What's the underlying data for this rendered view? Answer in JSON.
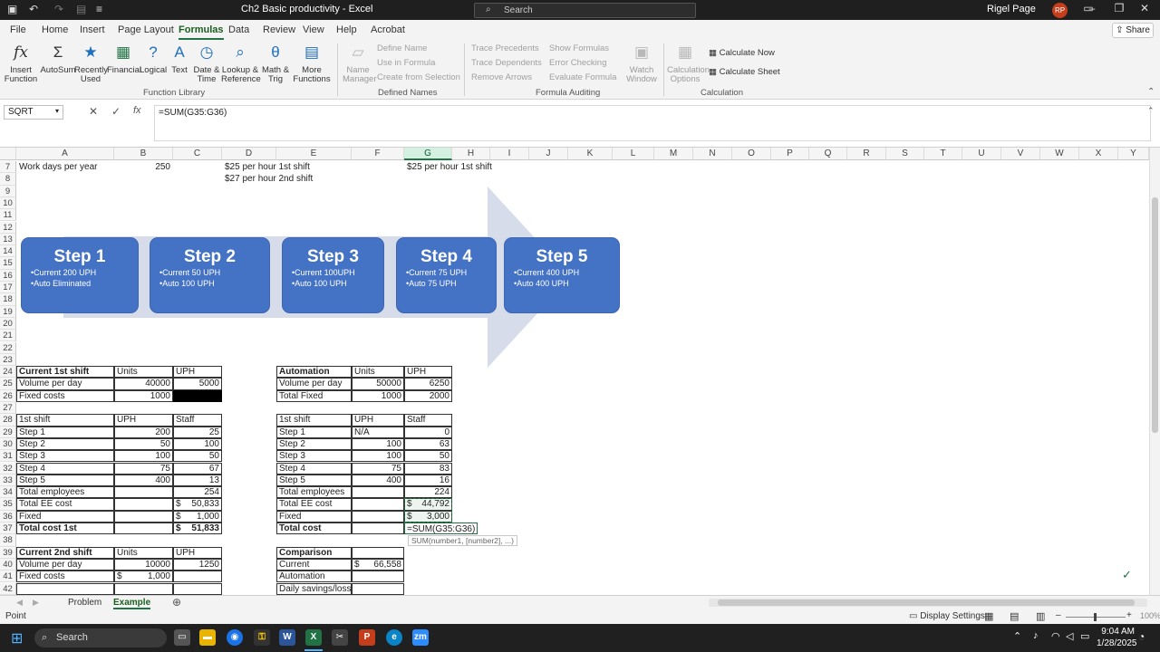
{
  "window": {
    "title": "Ch2 Basic productivity - Excel",
    "search_label": "Search",
    "user_name": "Rigel Page",
    "user_initials": "RP"
  },
  "tabs": [
    "File",
    "Home",
    "Insert",
    "Page Layout",
    "Formulas",
    "Data",
    "Review",
    "View",
    "Help",
    "Acrobat"
  ],
  "active_tab": "Formulas",
  "share_label": "Share",
  "ribbon": {
    "function_library": {
      "group_label": "Function Library",
      "insert_function": "Insert Function",
      "autosum": "AutoSum",
      "recently_used": "Recently Used",
      "financial": "Financial",
      "logical": "Logical",
      "text": "Text",
      "date_time": "Date & Time",
      "lookup_reference": "Lookup & Reference",
      "math_trig": "Math & Trig",
      "more_functions": "More Functions"
    },
    "defined_names": {
      "group_label": "Defined Names",
      "name_manager": "Name Manager",
      "define_name": "Define Name",
      "use_in_formula": "Use in Formula",
      "create_from_selection": "Create from Selection"
    },
    "formula_auditing": {
      "group_label": "Formula Auditing",
      "trace_precedents": "Trace Precedents",
      "trace_dependents": "Trace Dependents",
      "remove_arrows": "Remove Arrows",
      "show_formulas": "Show Formulas",
      "error_checking": "Error Checking",
      "evaluate_formula": "Evaluate Formula",
      "watch_window": "Watch Window"
    },
    "calculation": {
      "group_label": "Calculation",
      "calculation_options": "Calculation Options",
      "calculate_now": "Calculate Now",
      "calculate_sheet": "Calculate Sheet"
    }
  },
  "formula_bar": {
    "name_box": "SQRT",
    "formula": "=SUM(G35:G36)"
  },
  "columns": [
    "A",
    "B",
    "C",
    "D",
    "E",
    "F",
    "G",
    "H",
    "I",
    "J",
    "K",
    "L",
    "M",
    "N",
    "O",
    "P",
    "Q",
    "R",
    "S",
    "T",
    "U",
    "V",
    "W",
    "X",
    "Y"
  ],
  "rows": [
    "7",
    "8",
    "9",
    "10",
    "11",
    "12",
    "13",
    "14",
    "15",
    "16",
    "17",
    "18",
    "19",
    "20",
    "21",
    "22",
    "23",
    "24",
    "25",
    "26",
    "27",
    "28",
    "29",
    "30",
    "31",
    "32",
    "33",
    "34",
    "35",
    "36",
    "37",
    "38",
    "39",
    "40",
    "41",
    "42"
  ],
  "cells": {
    "A7": "Work days per year",
    "B7": "250",
    "D7": "$25 per hour 1st shift",
    "G7": "$25 per hour 1st shift",
    "D8": "$27 per hour 2nd shift",
    "A24": "Current 1st shift",
    "B24": "Units",
    "C24": "UPH",
    "A25": "Volume per day",
    "B25": "40000",
    "C25": "5000",
    "A26": "Fixed costs",
    "B26": "1000",
    "A28": "1st shift",
    "B28": "UPH",
    "C28": "Staff",
    "A29": "Step 1",
    "B29": "200",
    "C29": "25",
    "A30": "Step 2",
    "B30": "50",
    "C30": "100",
    "A31": "Step 3",
    "B31": "100",
    "C31": "50",
    "A32": "Step 4",
    "B32": "75",
    "C32": "67",
    "A33": "Step 5",
    "B33": "400",
    "C33": "13",
    "A34": "Total employees",
    "C34": "254",
    "A35": "Total EE cost",
    "C35_sym": "$",
    "C35": "50,833",
    "A36": "Fixed",
    "C36_sym": "$",
    "C36": "1,000",
    "A37": "Total cost 1st",
    "C37_sym": "$",
    "C37": "51,833",
    "A39": "Current 2nd shift",
    "B39": "Units",
    "C39": "UPH",
    "A40": "Volume per day",
    "B40": "10000",
    "C40": "1250",
    "A41": "Fixed costs",
    "B41_sym": "$",
    "B41": "1,000",
    "E24": "Automation",
    "F24": "Units",
    "G24": "UPH",
    "E25": "Volume per day",
    "F25": "50000",
    "G25": "6250",
    "E26": "Total Fixed",
    "F26": "1000",
    "G26": "2000",
    "E28": "1st shift",
    "F28": "UPH",
    "G28": "Staff",
    "E29": "Step 1",
    "F29": "N/A",
    "G29": "0",
    "E30": "Step 2",
    "F30": "100",
    "G30": "63",
    "E31": "Step 3",
    "F31": "100",
    "G31": "50",
    "E32": "Step 4",
    "F32": "75",
    "G32": "83",
    "E33": "Step 5",
    "F33": "400",
    "G33": "16",
    "E34": "Total employees",
    "G34": "224",
    "E35": "Total EE cost",
    "G35_sym": "$",
    "G35": "44,792",
    "E36": "Fixed",
    "G36_sym": "$",
    "G36": "3,000",
    "E37": "Total cost",
    "G37": "=SUM(G35:G36)",
    "E39": "Comparison",
    "E40": "Current",
    "F40_sym": "$",
    "F40": "66,558",
    "E41": "Automation",
    "E42": "Daily savings/loss"
  },
  "tooltip": "SUM(number1, [number2], ...)",
  "smartart": [
    {
      "title": "Step 1",
      "lines": [
        "•Current 200 UPH",
        "•Auto Eliminated"
      ]
    },
    {
      "title": "Step 2",
      "lines": [
        "•Current 50 UPH",
        "•Auto 100 UPH"
      ]
    },
    {
      "title": "Step 3",
      "lines": [
        "•Current 100UPH",
        "•Auto 100 UPH"
      ]
    },
    {
      "title": "Step 4",
      "lines": [
        "•Current 75 UPH",
        "•Auto 75 UPH"
      ]
    },
    {
      "title": "Step 5",
      "lines": [
        "•Current 400 UPH",
        "•Auto 400 UPH"
      ]
    }
  ],
  "sheets": [
    "Problem",
    "Example"
  ],
  "active_sheet": "Example",
  "status": {
    "mode": "Point",
    "display_settings": "Display Settings",
    "zoom": "100%"
  },
  "taskbar": {
    "search_label": "Search",
    "time": "9:04 AM",
    "date": "1/28/2025"
  }
}
